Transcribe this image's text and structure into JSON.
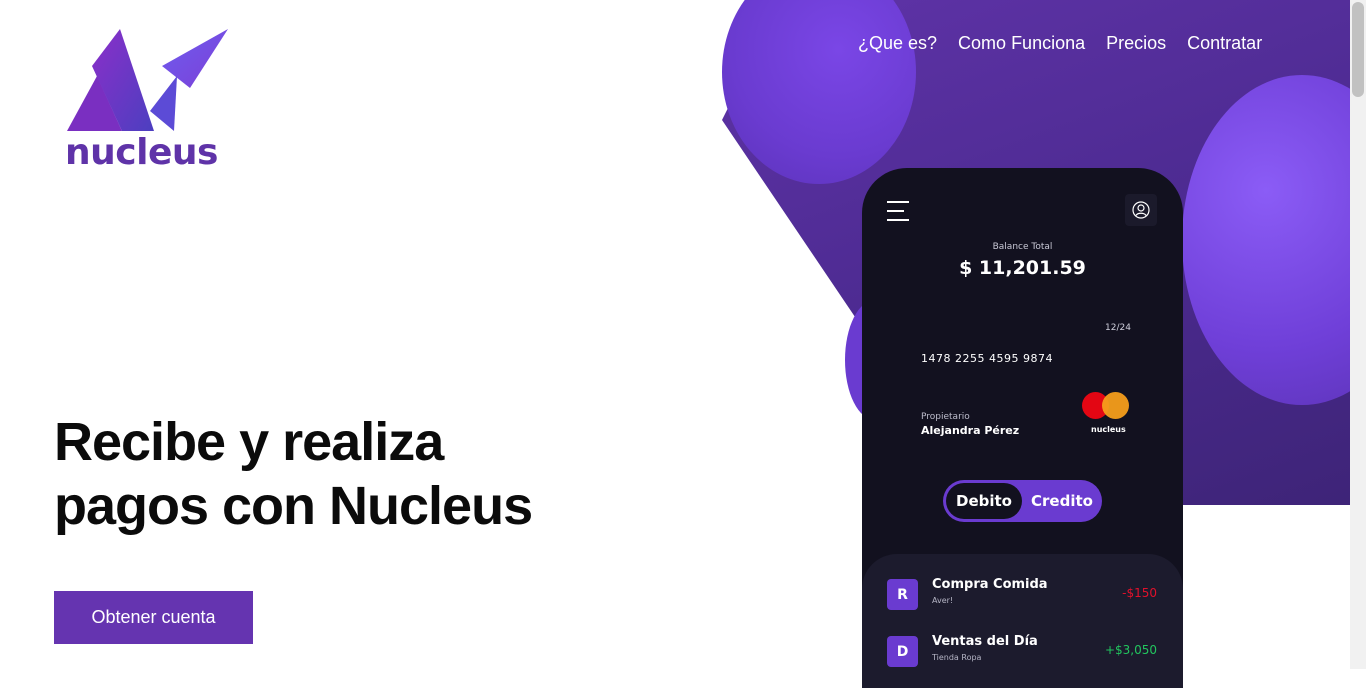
{
  "brand": {
    "logo_text": "nucleus",
    "colors": {
      "primary": "#6534b0",
      "dark": "#12111f"
    }
  },
  "nav": {
    "items": [
      "¿Que es?",
      "Como Funciona",
      "Precios",
      "Contratar"
    ]
  },
  "hero": {
    "line1": "Recibe y realiza",
    "line2": "pagos con Nucleus"
  },
  "cta": {
    "label": "Obtener cuenta"
  },
  "phone": {
    "balance_label": "Balance Total",
    "balance_amount": "$ 11,201.59",
    "card": {
      "expiry": "12/24",
      "number": "1478 2255 4595 9874",
      "owner_label": "Propietario",
      "owner_name": "Alejandra Pérez",
      "brand": "nucleus"
    },
    "toggle": {
      "debit": "Debito",
      "credit": "Credito"
    },
    "transactions": [
      {
        "initial": "R",
        "title": "Compra Comida",
        "subtitle": "Aver!",
        "amount": "-$150",
        "color": "#e0112b"
      },
      {
        "initial": "D",
        "title": "Ventas del Día",
        "subtitle": "Tienda Ropa",
        "amount": "+$3,050",
        "color": "#22c55e"
      }
    ]
  }
}
